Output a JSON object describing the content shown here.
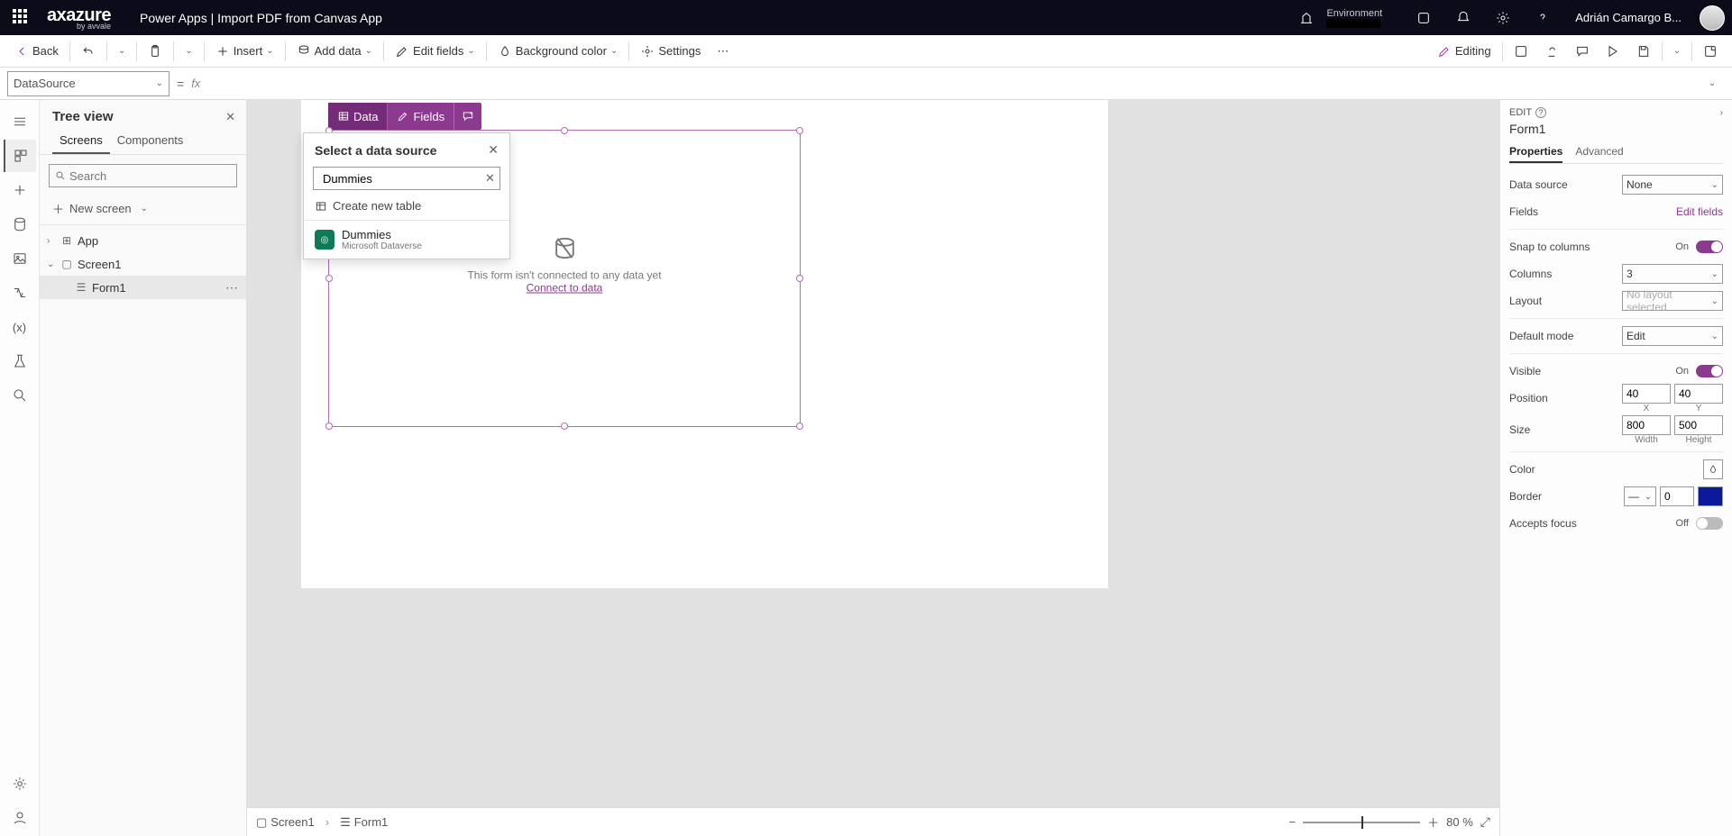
{
  "header": {
    "brand": "axazure",
    "brand_sub": "by avvale",
    "app_title": "Power Apps  |  Import PDF from Canvas App",
    "env_label": "Environment",
    "user_name": "Adrián Camargo B..."
  },
  "cmdbar": {
    "back": "Back",
    "insert": "Insert",
    "add_data": "Add data",
    "edit_fields": "Edit fields",
    "bg_color": "Background color",
    "settings": "Settings",
    "editing": "Editing"
  },
  "formula": {
    "property": "DataSource",
    "eq": "=",
    "fx": "fx"
  },
  "tree": {
    "title": "Tree view",
    "tabs": {
      "screens": "Screens",
      "components": "Components"
    },
    "search_placeholder": "Search",
    "new_screen": "New screen",
    "items": {
      "app": "App",
      "screen1": "Screen1",
      "form1": "Form1"
    }
  },
  "canvas": {
    "ctx": {
      "data": "Data",
      "fields": "Fields"
    },
    "ds_popup": {
      "title": "Select a data source",
      "search_value": "Dummies",
      "create": "Create new table",
      "result_name": "Dummies",
      "result_source": "Microsoft Dataverse"
    },
    "form_empty": {
      "msg": "This form isn't connected to any data yet",
      "link": "Connect to data"
    },
    "footer": {
      "zoom": "80  %"
    }
  },
  "props": {
    "edit_label": "EDIT",
    "control_name": "Form1",
    "tabs": {
      "properties": "Properties",
      "advanced": "Advanced"
    },
    "data_source": {
      "lbl": "Data source",
      "val": "None"
    },
    "fields": {
      "lbl": "Fields",
      "link": "Edit fields"
    },
    "snap": {
      "lbl": "Snap to columns",
      "state": "On"
    },
    "columns": {
      "lbl": "Columns",
      "val": "3"
    },
    "layout": {
      "lbl": "Layout",
      "val": "No layout selected"
    },
    "default_mode": {
      "lbl": "Default mode",
      "val": "Edit"
    },
    "visible": {
      "lbl": "Visible",
      "state": "On"
    },
    "position": {
      "lbl": "Position",
      "x": "40",
      "y": "40",
      "xl": "X",
      "yl": "Y"
    },
    "size": {
      "lbl": "Size",
      "w": "800",
      "h": "500",
      "wl": "Width",
      "hl": "Height"
    },
    "color": {
      "lbl": "Color"
    },
    "border": {
      "lbl": "Border",
      "val": "0"
    },
    "accepts_focus": {
      "lbl": "Accepts focus",
      "state": "Off"
    }
  }
}
